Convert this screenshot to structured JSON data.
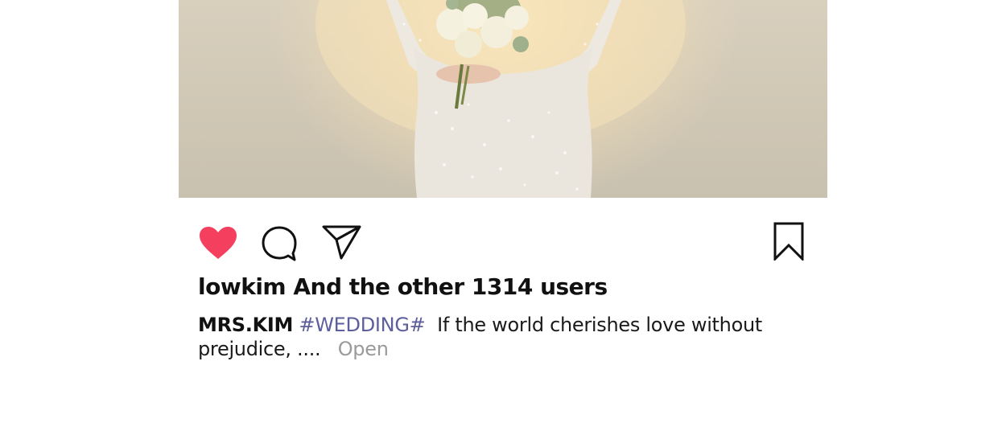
{
  "post": {
    "image_alt": "bride holding bouquet",
    "likes_text": "lowkim And the other 1314 users",
    "caption": {
      "author": "MRS.KIM",
      "hashtag": "#WEDDING#",
      "text_line1": "If the world cherishes love without",
      "text_line2": "prejudice, ....",
      "more_label": "Open"
    }
  },
  "actions": {
    "like_icon": "heart-icon",
    "comment_icon": "speech-bubble-icon",
    "share_icon": "paper-plane-icon",
    "save_icon": "bookmark-icon"
  },
  "colors": {
    "like_active": "#f43f5e",
    "hashtag": "#5d5e9c",
    "muted": "#9a9a9a"
  }
}
